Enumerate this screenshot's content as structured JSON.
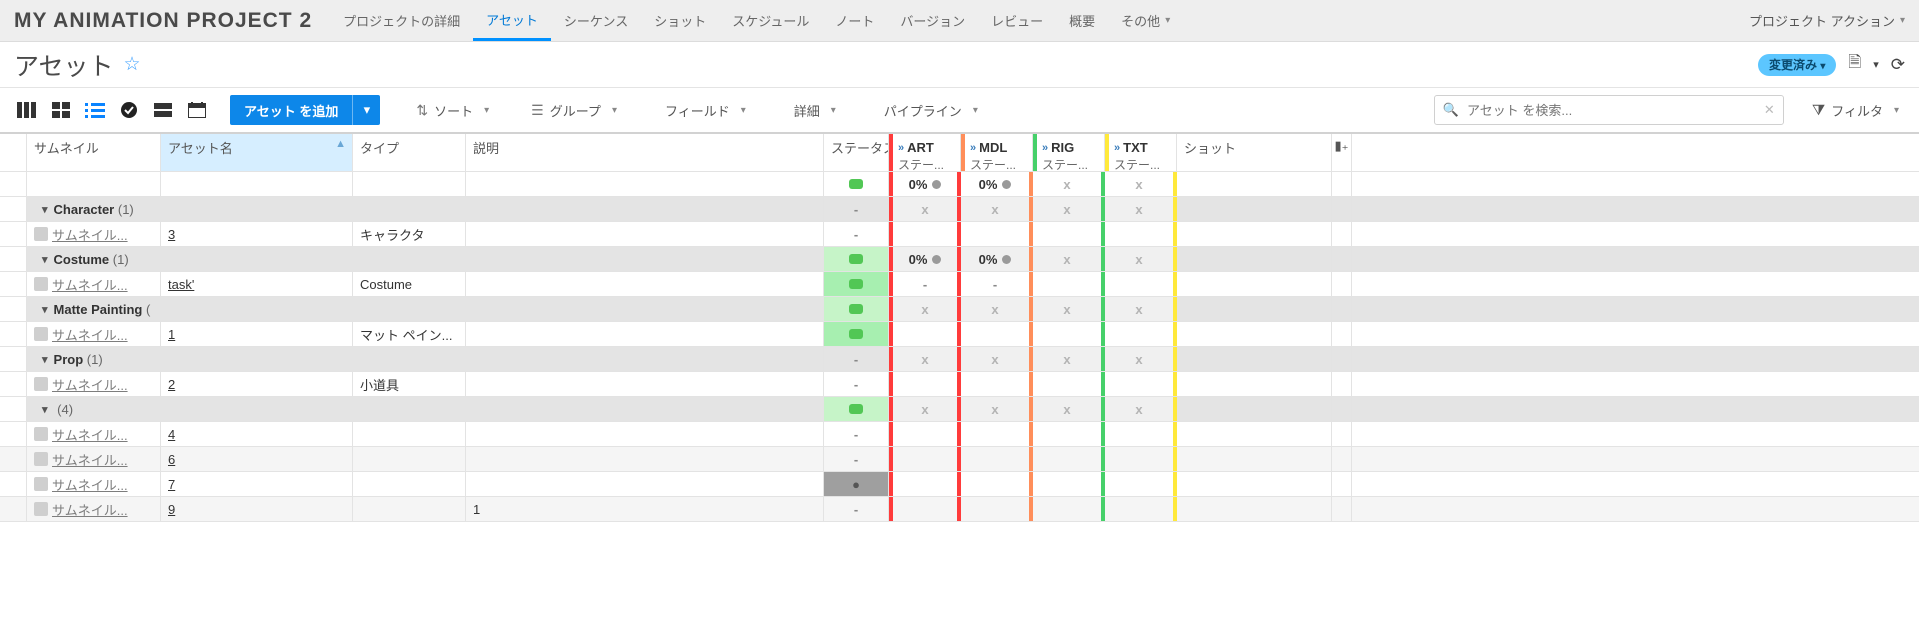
{
  "project_title": "MY ANIMATION PROJECT 2",
  "nav": {
    "tabs": [
      {
        "label": "プロジェクトの詳細"
      },
      {
        "label": "アセット",
        "active": true
      },
      {
        "label": "シーケンス"
      },
      {
        "label": "ショット"
      },
      {
        "label": "スケジュール"
      },
      {
        "label": "ノート"
      },
      {
        "label": "バージョン"
      },
      {
        "label": "レビュー"
      },
      {
        "label": "概要"
      },
      {
        "label": "その他",
        "dropdown": true
      }
    ],
    "project_action": "プロジェクト アクション"
  },
  "page": {
    "title": "アセット",
    "changed_label": "変更済み"
  },
  "toolbar": {
    "add_button": "アセット を追加",
    "sort": "ソート",
    "group": "グループ",
    "fields": "フィールド",
    "details": "詳細",
    "pipeline": "パイプライン",
    "search_placeholder": "アセット を検索...",
    "filter": "フィルタ"
  },
  "columns": {
    "thumbnail": "サムネイル",
    "asset_name": "アセット名",
    "type": "タイプ",
    "description": "説明",
    "status": "ステータス",
    "shot": "ショット",
    "step_sub": "ステー...",
    "steps": [
      {
        "code": "ART"
      },
      {
        "code": "MDL"
      },
      {
        "code": "RIG"
      },
      {
        "code": "TXT"
      }
    ]
  },
  "summary": {
    "status": "green",
    "art": "0%",
    "mdl": "0%",
    "rig": "x",
    "txt": "x"
  },
  "groups": [
    {
      "name": "Character",
      "count": "(1)",
      "agg": {
        "status": "-",
        "art": "x",
        "mdl": "x",
        "rig": "x",
        "txt": "x"
      },
      "rows": [
        {
          "thumb": "サムネイル...",
          "name": "3",
          "type": "キャラクタ",
          "desc": "",
          "status": "-",
          "art": "",
          "mdl": "",
          "rig": "",
          "txt": ""
        }
      ]
    },
    {
      "name": "Costume",
      "count": "(1)",
      "agg": {
        "status": "green",
        "art": "0%",
        "mdl": "0%",
        "rig": "x",
        "txt": "x"
      },
      "rows": [
        {
          "thumb": "サムネイル...",
          "name": "task'",
          "type": "Costume",
          "desc": "",
          "status": "green-md",
          "art": "-",
          "mdl": "-",
          "rig": "",
          "txt": ""
        }
      ]
    },
    {
      "name": "Matte Painting",
      "count": "(",
      "agg": {
        "status": "green",
        "art": "x",
        "mdl": "x",
        "rig": "x",
        "txt": "x"
      },
      "rows": [
        {
          "thumb": "サムネイル...",
          "name": "1",
          "type": "マット ペイン...",
          "desc": "",
          "status": "green-md",
          "art": "",
          "mdl": "",
          "rig": "",
          "txt": ""
        }
      ]
    },
    {
      "name": "Prop",
      "count": "(1)",
      "agg": {
        "status": "-",
        "art": "x",
        "mdl": "x",
        "rig": "x",
        "txt": "x"
      },
      "rows": [
        {
          "thumb": "サムネイル...",
          "name": "2",
          "type": "小道具",
          "desc": "",
          "status": "-",
          "art": "",
          "mdl": "",
          "rig": "",
          "txt": ""
        }
      ]
    },
    {
      "name": "",
      "count": "(4)",
      "agg": {
        "status": "green",
        "art": "x",
        "mdl": "x",
        "rig": "x",
        "txt": "x"
      },
      "rows": [
        {
          "thumb": "サムネイル...",
          "name": "4",
          "type": "",
          "desc": "",
          "status": "-",
          "art": "",
          "mdl": "",
          "rig": "",
          "txt": ""
        },
        {
          "thumb": "サムネイル...",
          "name": "6",
          "type": "",
          "desc": "",
          "status": "-",
          "art": "",
          "mdl": "",
          "rig": "",
          "txt": ""
        },
        {
          "thumb": "サムネイル...",
          "name": "7",
          "type": "",
          "desc": "",
          "status": "dark",
          "art": "",
          "mdl": "",
          "rig": "",
          "txt": ""
        },
        {
          "thumb": "サムネイル...",
          "name": "9",
          "type": "",
          "desc": "1",
          "status": "-",
          "art": "",
          "mdl": "",
          "rig": "",
          "txt": ""
        }
      ]
    }
  ]
}
